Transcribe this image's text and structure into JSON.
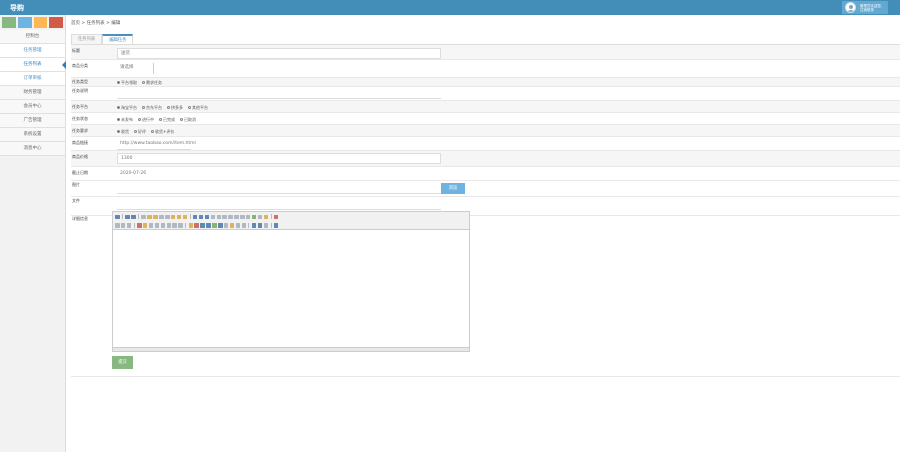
{
  "app": {
    "title": "导购"
  },
  "user": {
    "line1": "管理员欢迎您,",
    "line2": "注销登录"
  },
  "colors": {
    "topbar": "#438eb9",
    "shortcuts": [
      "#87b87f",
      "#6fb3e0",
      "#ffb752",
      "#d15b47"
    ],
    "blue_button": "#6fb3e0",
    "green_button": "#87b87f"
  },
  "sidebar": {
    "items": [
      {
        "label": "控制台"
      },
      {
        "label": "任务管理"
      },
      {
        "label": "任务列表"
      },
      {
        "label": "订单审核"
      },
      {
        "label": "财务管理"
      },
      {
        "label": "会员中心"
      },
      {
        "label": "广告管理"
      },
      {
        "label": "系统设置"
      },
      {
        "label": "消息中心"
      }
    ]
  },
  "breadcrumb": "首页 > 任务列表 > 编辑",
  "tabs": [
    {
      "label": "任务列表"
    },
    {
      "label": "编辑任务"
    }
  ],
  "form": {
    "title_label": "标题",
    "title_value": "送货",
    "cat_label": "商品分类",
    "cat_value": "请选择",
    "type_label": "任务类型",
    "type_opts": [
      "平台领取",
      "需求任务"
    ],
    "t4_label": "任务说明",
    "platform_label": "任务平台",
    "platform_opts": [
      "淘宝平台",
      "京东平台",
      "拼多多",
      "其他平台"
    ],
    "status_label": "任务状态",
    "status_opts": [
      "未发布",
      "进行中",
      "已完成",
      "已取消"
    ],
    "need_label": "任务要求",
    "need_opts": [
      "收货",
      "好评",
      "收货+评价"
    ],
    "link_label": "商品链接",
    "link_value": "http://www.taobao.com/item.html",
    "price_label": "商品价格",
    "price_value": "1300",
    "date_label": "截止日期",
    "date_value": "2020-07-26",
    "img_label": "图片",
    "upload_label": "浏览",
    "file_label": "文件",
    "content_label": "详细信息",
    "submit_label": "提交"
  }
}
